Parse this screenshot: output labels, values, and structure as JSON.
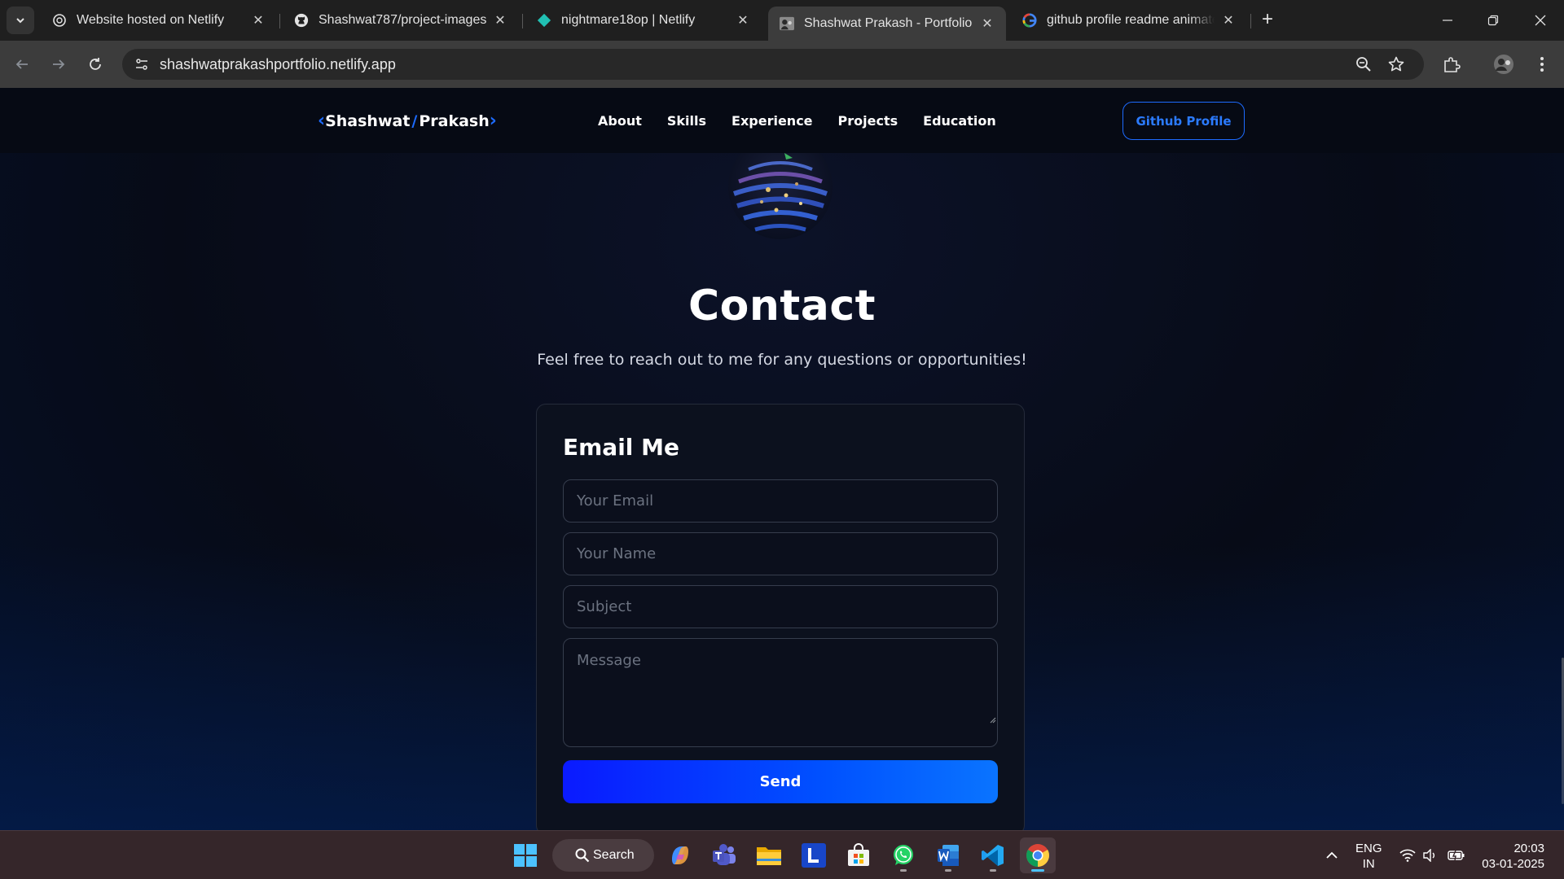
{
  "browser": {
    "tabs": [
      {
        "title": "Website hosted on Netlify",
        "icon": "netlify-chatgpt-icon"
      },
      {
        "title": "Shashwat787/project-images",
        "icon": "github-icon"
      },
      {
        "title": "nightmare18op | Netlify",
        "icon": "netlify-icon"
      },
      {
        "title": "Shashwat Prakash - Portfolio",
        "icon": "portfolio-avatar-icon",
        "active": true
      },
      {
        "title": "github profile readme animated",
        "icon": "google-icon"
      }
    ],
    "url": "shashwatprakashportfolio.netlify.app"
  },
  "site": {
    "logo_first": "Shashwat",
    "logo_slash": "/",
    "logo_last": "Prakash",
    "nav": [
      "About",
      "Skills",
      "Experience",
      "Projects",
      "Education"
    ],
    "github_button": "Github Profile",
    "contact_title": "Contact",
    "contact_subtitle": "Feel free to reach out to me for any questions or opportunities!",
    "form": {
      "title": "Email Me",
      "email_placeholder": "Your Email",
      "name_placeholder": "Your Name",
      "subject_placeholder": "Subject",
      "message_placeholder": "Message",
      "send_label": "Send"
    }
  },
  "taskbar": {
    "search_label": "Search",
    "lang_line1": "ENG",
    "lang_line2": "IN",
    "time": "20:03",
    "date": "03-01-2025",
    "accent": "#4cc2ff"
  },
  "colors": {
    "brand_blue": "#1d6bff",
    "send_gradient_start": "#0a1aff",
    "send_gradient_end": "#0a74ff"
  }
}
